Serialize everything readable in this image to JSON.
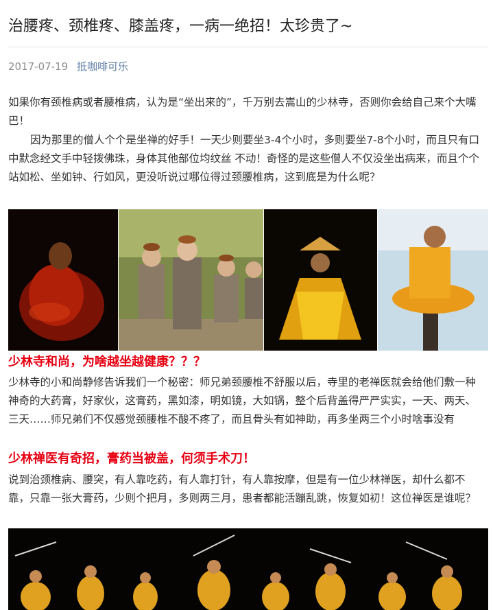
{
  "article": {
    "title": "治腰疼、颈椎疼、膝盖疼，一病一绝招！太珍贵了~",
    "date": "2017-07-19",
    "author": "抵咖啡可乐",
    "para1": "如果你有颈椎病或者腰椎病，认为是“坐出来的”，千万别去嵩山的少林寺，否则你会给自己来个大嘴巴！",
    "para2": "因为那里的僧人个个是坐禅的好手！一天少则要坐3-4个小时，多则要坐7-8个小时，而且只有口中默念经文手中轻拨佛珠，身体其他部位均纹丝 不动！奇怪的是这些僧人不仅没坐出病来，而且个个站如松、坐如钟、行如风，更没听说过哪位得过颈腰椎病，这到底是为什么呢？",
    "heading1": "少林寺和尚，为啥越坐越健康？？？",
    "para3": "少林寺的小和尚静修告诉我们一个秘密：师兄弟颈腰椎不舒服以后，寺里的老禅医就会给他们敷一种神奇的大药膏，好家伙，这膏药，黑如漆，明如镜，大如锅，整个后背盖得严严实实，一天、两天、三天……师兄弟们不仅感觉颈腰椎不酸不疼了，而且骨头有如神助，再多坐两三个小时啥事没有",
    "heading2": "少林禅医有奇招，膏药当被盖，何须手术刀！",
    "para4": "说到治颈椎病、腰突，有人靠吃药，有人靠打针，有人靠按摩，但是有一位少林禅医，却什么都不靠，只靠一张大膏药，少则个把月，多则两三月，患者都能活蹦乱跳，恢复如初！这位禅医是谁呢？"
  },
  "colors": {
    "accent_red": "#e60012",
    "author_link": "#607fa6",
    "date_gray": "#8c8c8c"
  }
}
